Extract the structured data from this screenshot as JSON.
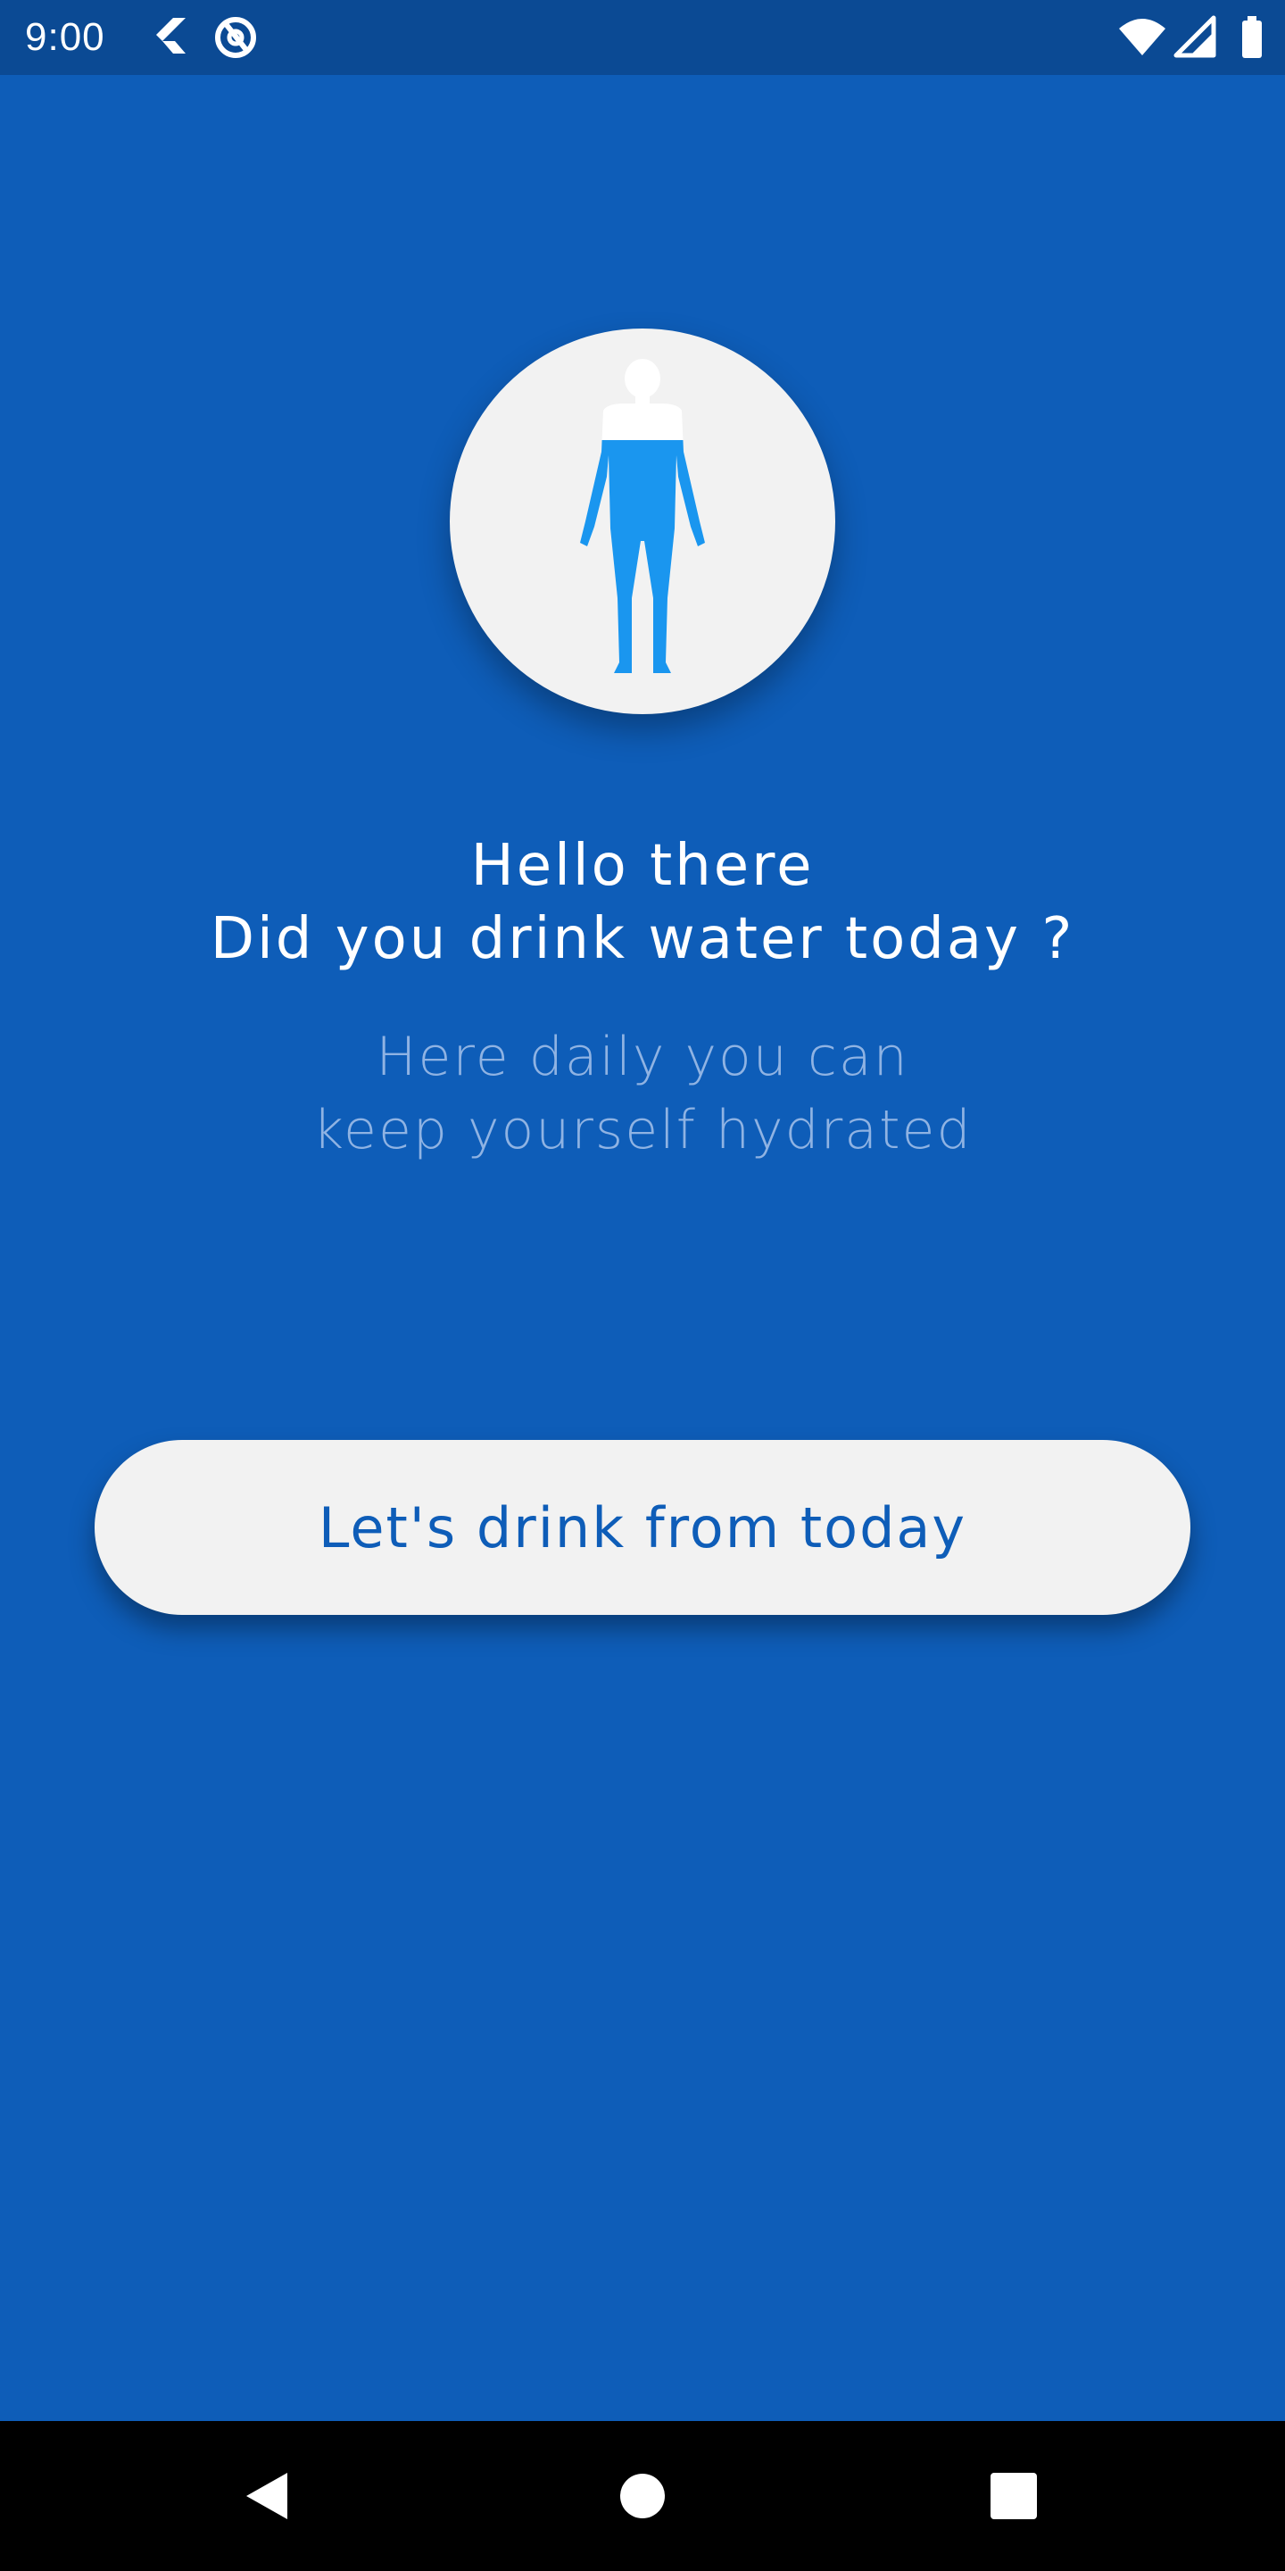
{
  "status_bar": {
    "time": "9:00",
    "left_icons": [
      "flutter-icon",
      "at-sign-icon"
    ],
    "right_icons": [
      "wifi-icon",
      "cell-signal-icon",
      "battery-icon"
    ]
  },
  "hero": {
    "icon": "human-body-icon",
    "water_level": 0.75
  },
  "title": {
    "line1": "Hello there",
    "line2": "Did you drink water today ?"
  },
  "subtitle": {
    "line1": "Here daily you can",
    "line2": "keep yourself hydrated"
  },
  "cta": {
    "label": "Let's drink from today"
  },
  "nav_bar": {
    "buttons": [
      "back-icon",
      "home-icon",
      "recents-icon"
    ]
  },
  "colors": {
    "background": "#0e5db8",
    "status_bar": "#0b4a94",
    "card": "#f2f2f2",
    "water": "#1a96ef",
    "subtitle": "#8fb3e3"
  }
}
